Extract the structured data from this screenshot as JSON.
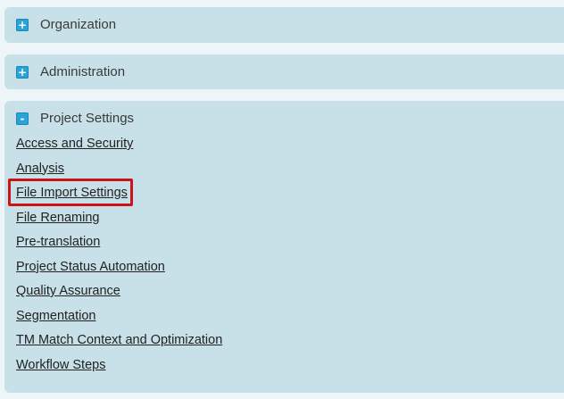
{
  "panels": {
    "organization": {
      "label": "Organization",
      "toggle": "+"
    },
    "administration": {
      "label": "Administration",
      "toggle": "+"
    },
    "project_settings": {
      "label": "Project Settings",
      "toggle": "-",
      "links": [
        "Access and Security",
        "Analysis",
        "File Import Settings",
        "File Renaming",
        "Pre-translation",
        "Project Status Automation",
        "Quality Assurance",
        "Segmentation",
        "TM Match Context and Optimization",
        "Workflow Steps"
      ]
    }
  },
  "colors": {
    "panel_bg": "#c8e0e8",
    "toggle": "#2aa3d6",
    "highlight": "#cc1418"
  },
  "highlighted_link": "File Import Settings"
}
